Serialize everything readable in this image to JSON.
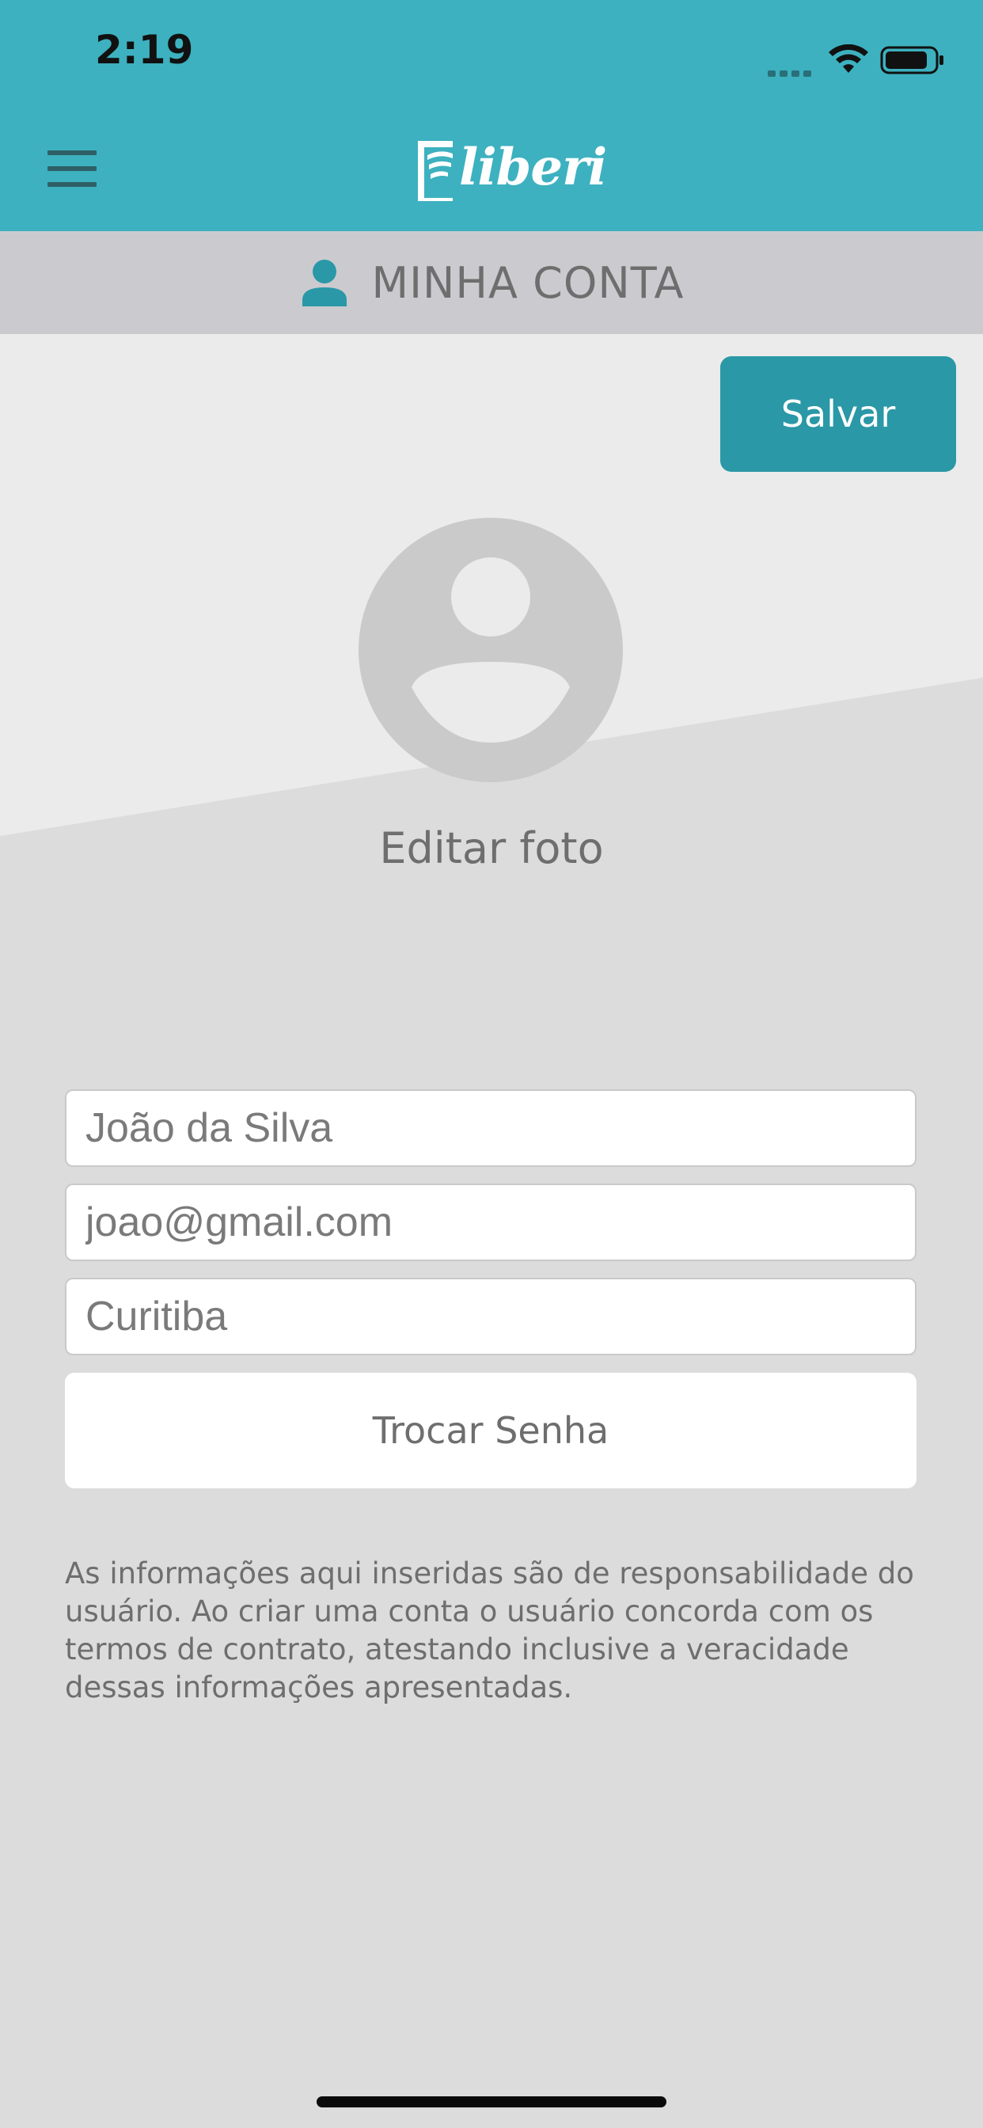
{
  "status_bar": {
    "time": "2:19"
  },
  "header": {
    "logo_text": "liberi",
    "brand_color": "#3db1bf"
  },
  "section": {
    "title": "MINHA CONTA",
    "icon": "person-icon"
  },
  "actions": {
    "save_label": "Salvar",
    "save_color": "#2a98a6"
  },
  "profile": {
    "edit_photo_label": "Editar foto"
  },
  "form": {
    "name_value": "João da Silva",
    "email_value": "joao@gmail.com",
    "city_value": "Curitiba",
    "change_password_label": "Trocar Senha"
  },
  "disclaimer": "As informações aqui inseridas são de responsabilidade do usuário. Ao criar uma conta o usuário concorda com os termos de contrato, atestando inclusive a veracidade dessas informações apresentadas."
}
